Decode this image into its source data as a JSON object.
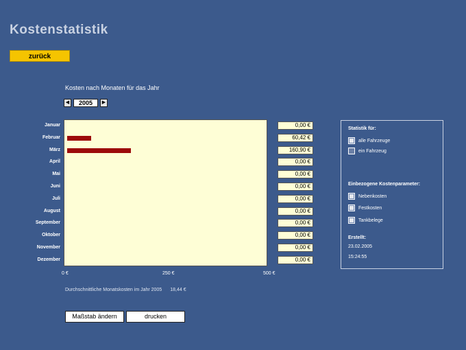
{
  "page_title": "Kostenstatistik",
  "back_label": "zurück",
  "chart_heading": "Kosten nach Monaten für das Jahr",
  "year": "2005",
  "nav": {
    "prev": "◀",
    "next": "▶"
  },
  "chart_data": {
    "type": "bar",
    "orientation": "horizontal",
    "categories": [
      "Januar",
      "Februar",
      "März",
      "April",
      "Mai",
      "Juni",
      "Juli",
      "August",
      "September",
      "Oktober",
      "November",
      "Dezember"
    ],
    "values": [
      0,
      60.42,
      160.9,
      0,
      0,
      0,
      0,
      0,
      0,
      0,
      0,
      0
    ],
    "value_labels": [
      "0,00 €",
      "60,42 €",
      "160,90 €",
      "0,00 €",
      "0,00 €",
      "0,00 €",
      "0,00 €",
      "0,00 €",
      "0,00 €",
      "0,00 €",
      "0,00 €",
      "0,00 €"
    ],
    "xlim": [
      0,
      500
    ],
    "x_ticks": [
      "0 €",
      "250 €",
      "500 €"
    ],
    "bar_color": "#9c0a0a",
    "plot_background": "#fefed6"
  },
  "average": {
    "label": "Durchschnittliche Monatskosten im Jahr 2005",
    "value": "18,44 €"
  },
  "buttons": {
    "scale": "Maßstab ändern",
    "print": "drucken"
  },
  "side_panel": {
    "statistik_heading": "Statistik für:",
    "vehicle_options": [
      {
        "label": "alle Fahrzeuge",
        "checked": true
      },
      {
        "label": "ein Fahrzeug",
        "checked": false
      }
    ],
    "params_heading": "Einbezogene Kostenparameter:",
    "params": [
      {
        "label": "Nebenkosten",
        "checked": true
      },
      {
        "label": "Festkosten",
        "checked": true
      },
      {
        "label": "Tankbelege",
        "checked": true
      }
    ],
    "created_label": "Erstellt:",
    "created_date": "23.02.2005",
    "created_time": "15:24:55"
  },
  "colors": {
    "background": "#3c5a8c",
    "back_button": "#f5c400"
  }
}
